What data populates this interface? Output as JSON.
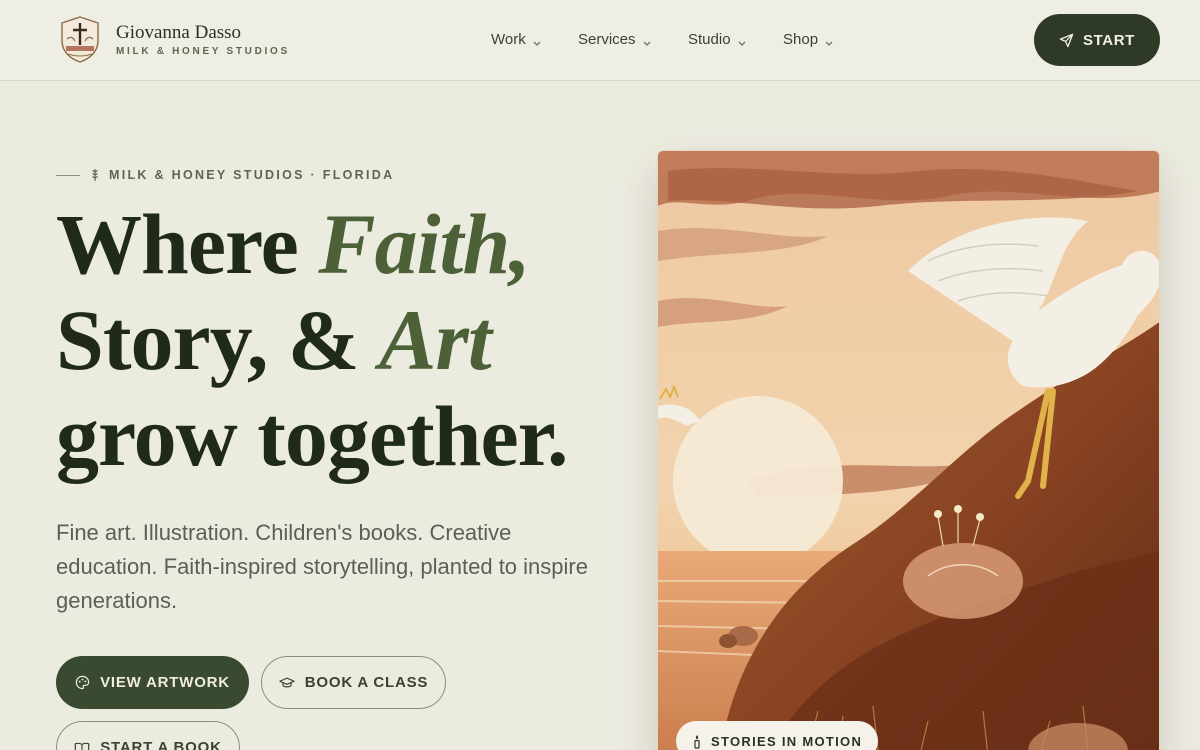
{
  "brand": {
    "name": "Giovanna Dasso",
    "subtitle": "MILK & HONEY STUDIOS"
  },
  "nav": {
    "items": [
      {
        "label": "Work"
      },
      {
        "label": "Services"
      },
      {
        "label": "Studio"
      },
      {
        "label": "Shop"
      }
    ],
    "start_label": "START"
  },
  "hero": {
    "eyebrow": "MILK & HONEY STUDIOS · FLORIDA",
    "headline": {
      "l1a": "Where ",
      "l1b": "Faith,",
      "l2a": "Story, & ",
      "l2b": "Art",
      "l3": "grow together."
    },
    "lede": "Fine art. Illustration. Children's books. Creative education. Faith-inspired storytelling, planted to inspire generations.",
    "buttons": {
      "view_artwork": "VIEW ARTWORK",
      "book_class": "BOOK A CLASS",
      "start_book": "START A BOOK"
    }
  },
  "artwork": {
    "badge": "STORIES IN MOTION"
  },
  "colors": {
    "background": "#ecebe0",
    "primary": "#2e3a26",
    "accent_italic": "#4c6138"
  },
  "icons": [
    "logo-emblem",
    "chevron-down-icon",
    "send-icon",
    "wheat-icon",
    "palette-icon",
    "graduation-cap-icon",
    "book-icon",
    "candle-icon"
  ]
}
